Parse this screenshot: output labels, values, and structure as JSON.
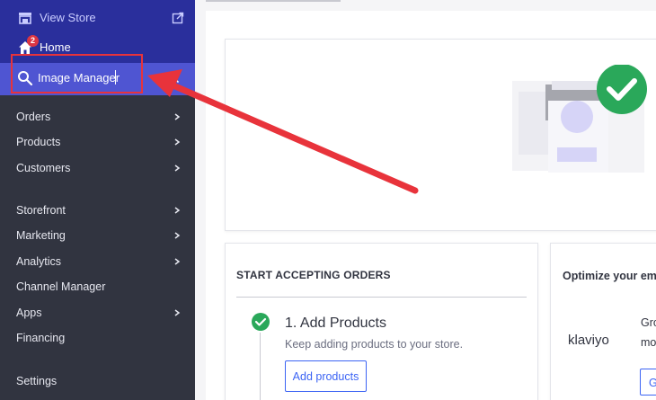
{
  "sidebar": {
    "view_store": "View Store",
    "home": "Home",
    "home_badge": "2",
    "search": {
      "value": "Image Manager",
      "placeholder": ""
    },
    "items": [
      {
        "label": "Orders",
        "chevron": true
      },
      {
        "label": "Products",
        "chevron": true
      },
      {
        "label": "Customers",
        "chevron": true
      },
      {
        "label": "Storefront",
        "chevron": true
      },
      {
        "label": "Marketing",
        "chevron": true
      },
      {
        "label": "Analytics",
        "chevron": true
      },
      {
        "label": "Channel Manager",
        "chevron": false
      },
      {
        "label": "Apps",
        "chevron": true
      },
      {
        "label": "Financing",
        "chevron": false
      },
      {
        "label": "Settings",
        "chevron": false
      }
    ]
  },
  "main": {
    "start_card": {
      "title": "START ACCEPTING ORDERS",
      "step_title": "1. Add Products",
      "step_desc": "Keep adding products to your store.",
      "button": "Add products"
    },
    "optimize_card": {
      "title": "Optimize your ema",
      "logo": "klaviyo",
      "text_line1": "Gro",
      "text_line2": "mo",
      "button": "G"
    }
  },
  "colors": {
    "sidebar_bg": "#313440",
    "sidebar_top": "#2a2f9c",
    "search_band": "#4f55d2",
    "accent": "#3c64f4",
    "success": "#2aa85a",
    "annotation_red": "#e8333b"
  },
  "icons": [
    "storefront-icon",
    "external-link-icon",
    "home-icon",
    "search-icon",
    "close-icon",
    "chevron-right-icon",
    "check-circle-icon"
  ]
}
